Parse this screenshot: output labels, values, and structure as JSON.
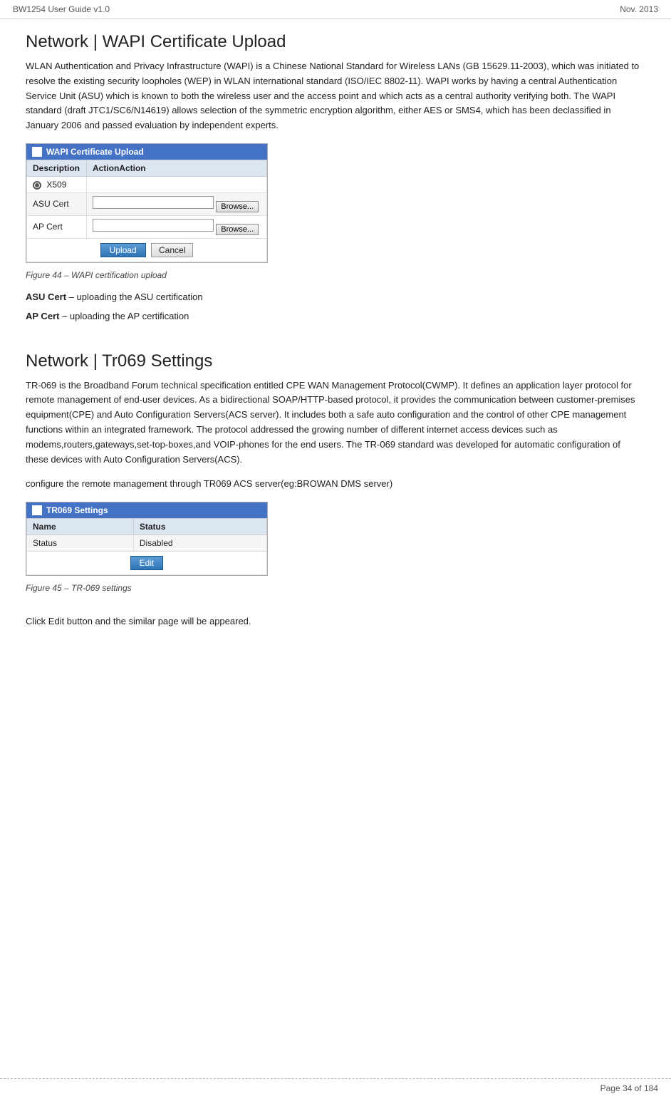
{
  "header": {
    "left": "BW1254 User Guide v1.0",
    "right": "Nov.  2013"
  },
  "section1": {
    "title": "Network | WAPI Certificate Upload",
    "description": "WLAN Authentication and Privacy Infrastructure (WAPI) is a Chinese National Standard for Wireless LANs (GB 15629.11-2003), which was initiated to resolve the existing security loopholes (WEP) in WLAN international standard (ISO/IEC 8802-11). WAPI works by having a central Authentication Service Unit (ASU) which is known to both the wireless user and the access point and which acts as a central authority verifying both. The WAPI standard (draft JTC1/SC6/N14619) allows selection of the symmetric encryption algorithm, either AES or SMS4, which has been declassified in January 2006 and passed evaluation by independent experts.",
    "panel": {
      "title": "WAPI Certificate Upload",
      "col1_header": "Description",
      "col2_header": "ActionAction",
      "row1_label": "X509",
      "row2_label": "ASU Cert",
      "row3_label": "AP Cert",
      "browse_label": "Browse...",
      "upload_label": "Upload",
      "cancel_label": "Cancel"
    },
    "figure_caption": "Figure 44 – WAPI certification upload",
    "asu_cert_label": "ASU Cert",
    "asu_cert_desc": "– uploading the ASU certification",
    "ap_cert_label": "AP Cert",
    "ap_cert_desc": "–  uploading the AP certification"
  },
  "section2": {
    "title": "Network | Tr069 Settings",
    "description": "TR-069 is the Broadband Forum technical specification entitled CPE WAN Management Protocol(CWMP). It defines an application layer protocol for remote management of end-user devices. As a bidirectional SOAP/HTTP-based protocol, it provides the communication between customer-premises equipment(CPE) and Auto Configuration Servers(ACS server). It includes both a safe auto configuration and the control of other CPE management functions within an integrated framework. The protocol addressed the growing number of different internet access devices such as modems,routers,gateways,set-top-boxes,and VOIP-phones for the end users. The TR-069 standard was developed for automatic configuration of these devices with Auto Configuration Servers(ACS).",
    "configure_text": "configure the remote management through TR069 ACS server(eg:BROWAN DMS server)",
    "panel": {
      "title": "TR069 Settings",
      "col1_header": "Name",
      "col2_header": "Status",
      "row1_label": "Status",
      "row1_value": "Disabled",
      "edit_label": "Edit"
    },
    "figure_caption": "Figure 45 – TR-069 settings",
    "click_edit_text": "Click Edit button and the similar page will be appeared."
  },
  "footer": {
    "page_info": "Page 34 of 184"
  }
}
